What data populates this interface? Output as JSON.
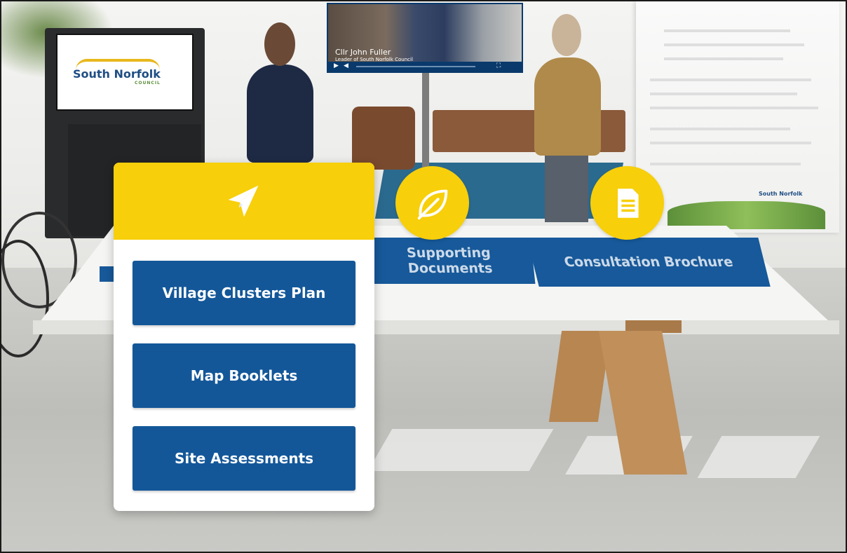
{
  "kiosk": {
    "brand_text": "South Norfolk",
    "brand_subtext": "COUNCIL"
  },
  "video": {
    "caption": "Cllr John Fuller",
    "caption_sub": "Leader of South Norfolk Council"
  },
  "banner": {
    "logo_text": "South Norfolk"
  },
  "table_tiles": {
    "supporting_documents": "Supporting Documents",
    "consultation_brochure": "Consultation Brochure"
  },
  "icons": {
    "panel_header": "paper-plane-icon",
    "supporting_documents": "leaf-icon",
    "consultation_brochure": "document-icon"
  },
  "colors": {
    "accent_yellow": "#f7cf0a",
    "primary_blue": "#135799"
  },
  "panel": {
    "buttons": [
      {
        "label": "Village Clusters Plan"
      },
      {
        "label": "Map Booklets"
      },
      {
        "label": "Site Assessments"
      }
    ]
  }
}
